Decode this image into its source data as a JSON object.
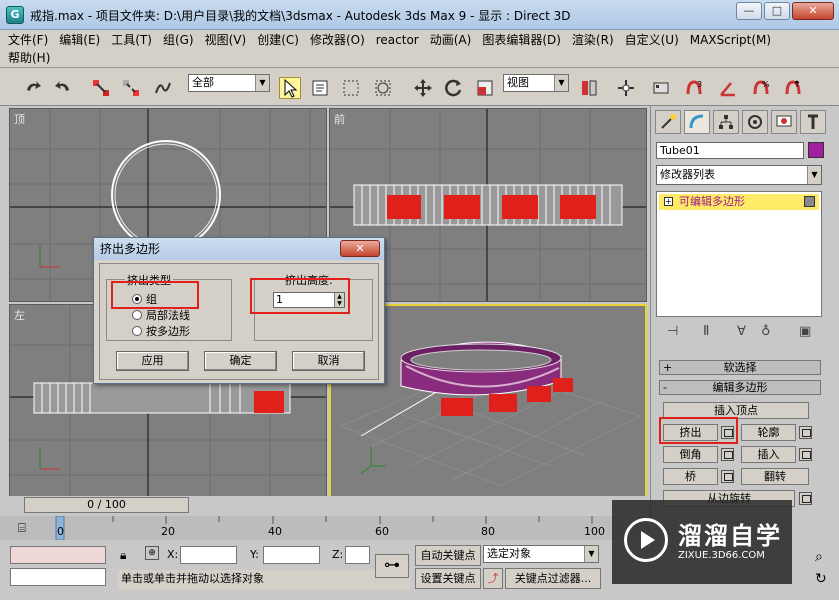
{
  "window": {
    "title": "戒指.max     - 项目文件夹: D:\\用户目录\\我的文档\\3dsmax     - Autodesk 3ds Max 9     - 显示 : Direct 3D",
    "minimize": "—",
    "restore": "□",
    "close": "✕"
  },
  "menu": {
    "row1": [
      "文件(F)",
      "编辑(E)",
      "工具(T)",
      "组(G)",
      "视图(V)",
      "创建(C)",
      "修改器(O)",
      "reactor",
      "动画(A)",
      "图表编辑器(D)",
      "渲染(R)",
      "自定义(U)",
      "MAXScript(M)"
    ],
    "row2": [
      "帮助(H)"
    ]
  },
  "toolbar": {
    "selection_filter": "全部",
    "reference_coord": "视图"
  },
  "viewports": {
    "top": "顶",
    "front": "前",
    "left": "左",
    "perspective": ""
  },
  "command_panel": {
    "object_name": "Tube01",
    "modifier_list": "修改器列表",
    "stack_item": "可编辑多边形",
    "rollout_select": "软选择",
    "rollout_edit": "编辑多边形",
    "btn_insert_vertex": "插入顶点",
    "btn_extrude": "挤出",
    "btn_outline": "轮廓",
    "btn_bevel": "倒角",
    "btn_inset": "插入",
    "btn_bridge": "桥",
    "btn_flip": "翻转",
    "btn_hinge": "从边旋转"
  },
  "dialog": {
    "title": "挤出多边形",
    "close": "✕",
    "extrusion_type_label": "挤出类型",
    "option_group": "组",
    "option_local_normal": "局部法线",
    "option_by_polygon": "按多边形",
    "height_label": "挤出高度:",
    "height_value": "1",
    "apply": "应用",
    "ok": "确定",
    "cancel": "取消"
  },
  "timeline": {
    "frame_readout": "0 / 100",
    "ticks": [
      "0",
      "20",
      "40",
      "60",
      "80",
      "100"
    ]
  },
  "status": {
    "x_label": "X:",
    "y_label": "Y:",
    "z_label": "Z:",
    "auto_key": "自动关键点",
    "set_key": "设置关键点",
    "selected_object": "选定对象",
    "key_filters": "关键点过滤器...",
    "prompt": "单击或单击并拖动以选择对象"
  },
  "watermark": {
    "title": "溜溜自学",
    "subtitle": "ZIXUE.3D66.COM"
  },
  "colors": {
    "viewport_bg": "#7f7f7f",
    "active_border": "#e8d431",
    "selection_red": "#e0201a",
    "object_purple": "#a020a0",
    "stack_highlight": "#ffeb66"
  }
}
